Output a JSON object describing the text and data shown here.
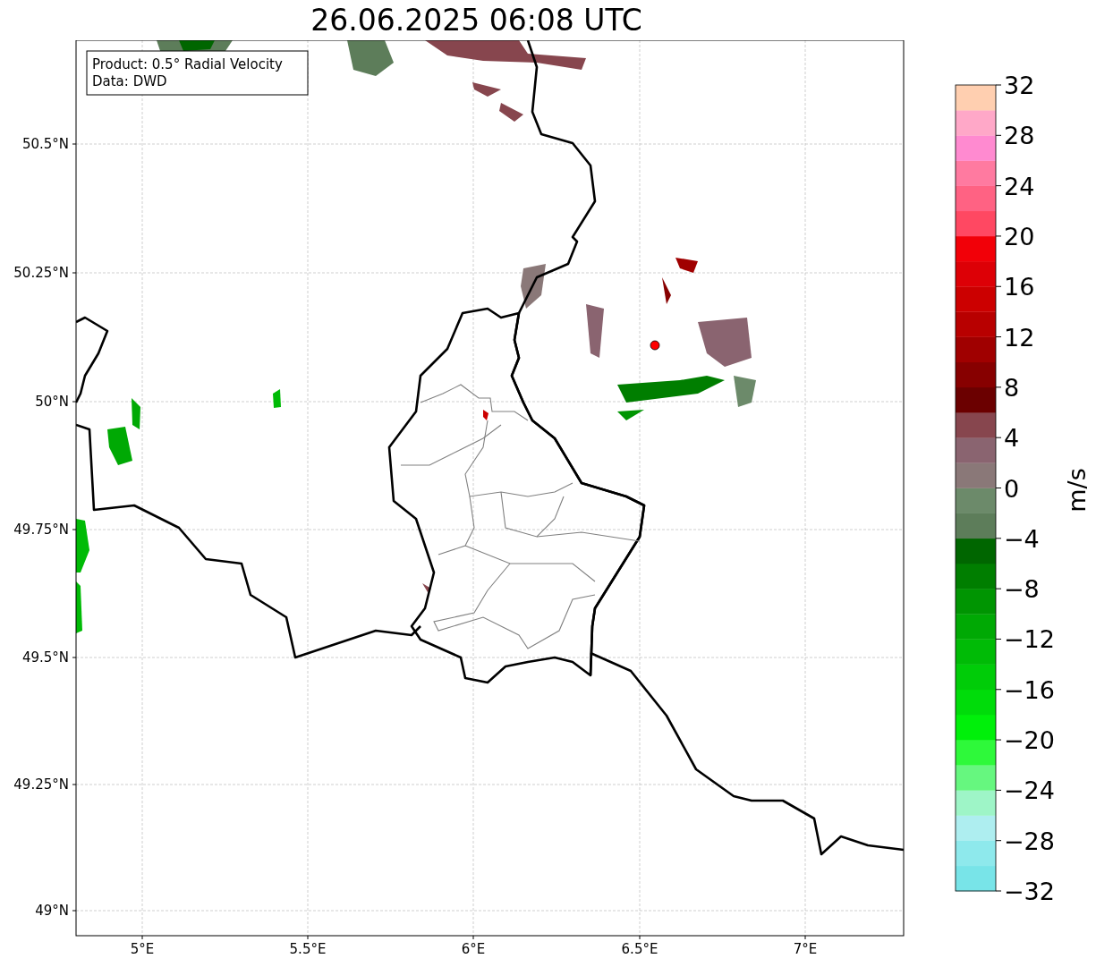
{
  "title": "26.06.2025 06:08 UTC",
  "info_box": {
    "lines": [
      "Product: 0.5° Radial Velocity",
      "Data: DWD"
    ]
  },
  "map": {
    "y_ticks": [
      "50.5°N",
      "50.25°N",
      "50°N",
      "49.75°N",
      "49.5°N",
      "49.25°N",
      "49°N"
    ],
    "x_ticks": [
      "5°E",
      "5.5°E",
      "6°E",
      "6.5°E",
      "7°E"
    ]
  },
  "colorbar": {
    "label": "m/s",
    "ticks": [
      "32",
      "28",
      "24",
      "20",
      "16",
      "12",
      "8",
      "4",
      "0",
      "−4",
      "−8",
      "−12",
      "−16",
      "−20",
      "−24",
      "−28",
      "−32"
    ],
    "bands": [
      {
        "color": "#78e4e8"
      },
      {
        "color": "#8ee9ec"
      },
      {
        "color": "#aeeef0"
      },
      {
        "color": "#9ef5c7"
      },
      {
        "color": "#66f77f"
      },
      {
        "color": "#2ef93a"
      },
      {
        "color": "#00f00a"
      },
      {
        "color": "#00dc0a"
      },
      {
        "color": "#00cc08"
      },
      {
        "color": "#00bb06"
      },
      {
        "color": "#00a904"
      },
      {
        "color": "#009502"
      },
      {
        "color": "#007e00"
      },
      {
        "color": "#006600"
      },
      {
        "color": "#5d7d5a"
      },
      {
        "color": "#6c8a6a"
      },
      {
        "color": "#8a7878"
      },
      {
        "color": "#8a6470"
      },
      {
        "color": "#87464e"
      },
      {
        "color": "#6b0000"
      },
      {
        "color": "#870000"
      },
      {
        "color": "#a00000"
      },
      {
        "color": "#b80000"
      },
      {
        "color": "#cc0000"
      },
      {
        "color": "#dd0006"
      },
      {
        "color": "#f20008"
      },
      {
        "color": "#ff4862"
      },
      {
        "color": "#ff6283"
      },
      {
        "color": "#ff7aa0"
      },
      {
        "color": "#ff8ad0"
      },
      {
        "color": "#ffa8c8"
      },
      {
        "color": "#ffcfb0"
      }
    ]
  }
}
